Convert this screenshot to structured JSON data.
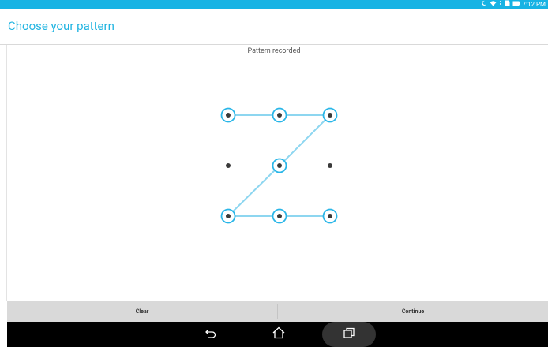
{
  "status_bar": {
    "time": "7:12 PM",
    "icons": [
      "moon-icon",
      "wifi-icon",
      "download-icon",
      "sd-card-icon",
      "battery-icon"
    ]
  },
  "header": {
    "title": "Choose your pattern"
  },
  "pattern": {
    "status": "Pattern recorded",
    "grid": "3x3",
    "selected_sequence": [
      1,
      2,
      3,
      5,
      7,
      8,
      9
    ]
  },
  "actions": {
    "clear_label": "Clear",
    "continue_label": "Continue"
  },
  "nav": {
    "items": [
      "back-icon",
      "home-icon",
      "recents-icon"
    ]
  },
  "colors": {
    "accent": "#21b4e1",
    "status_bar": "#17b3e4",
    "pattern_line": "#8dd6f0",
    "dot": "#3a3a3a",
    "button_bar": "#d9d9d9",
    "nav_bar": "#000000"
  }
}
